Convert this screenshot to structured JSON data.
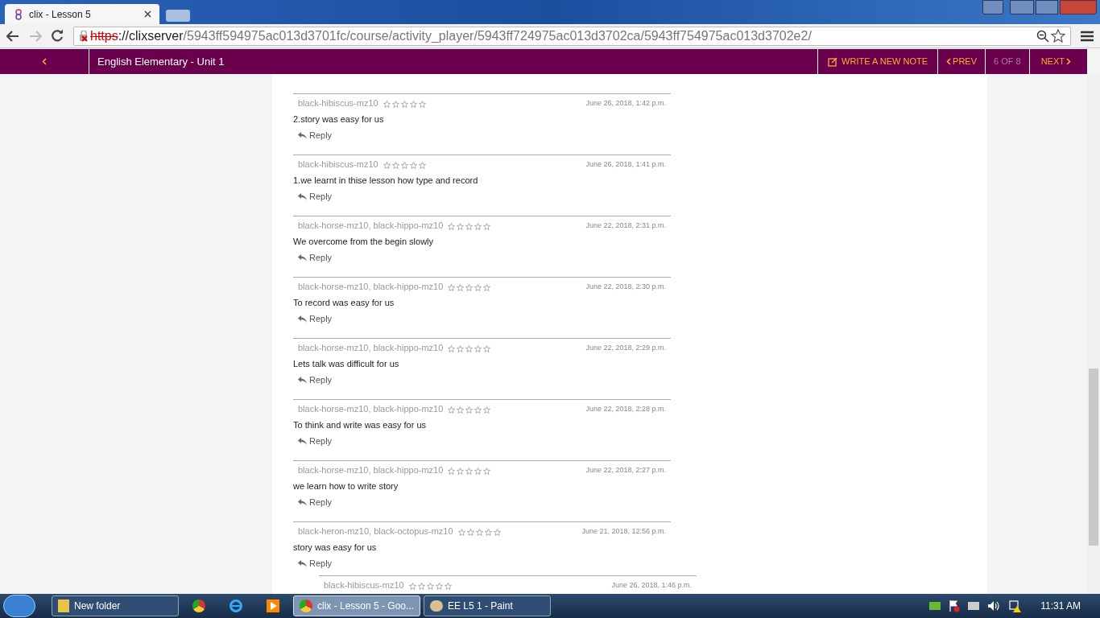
{
  "browser": {
    "tab_title": "clix - Lesson 5",
    "url_scheme": "https",
    "url_host": "://clixserver",
    "url_path": "/5943ff594975ac013d3701fc/course/activity_player/5943ff724975ac013d3702ca/5943ff754975ac013d3702e2/"
  },
  "header": {
    "title": "English Elementary - Unit 1",
    "write_note": "WRITE A NEW NOTE",
    "prev": "PREV",
    "position": "6 OF 8",
    "next": "NEXT"
  },
  "comments": [
    {
      "authors": "black-hibiscus-mz10",
      "stars": 0,
      "date": "June 26, 2018, 1:42 p.m.",
      "text": "2.story was easy for us",
      "reply": "Reply"
    },
    {
      "authors": "black-hibiscus-mz10",
      "stars": 0,
      "date": "June 26, 2018, 1:41 p.m.",
      "text": "1.we learnt in thise lesson how type and record",
      "reply": "Reply"
    },
    {
      "authors": "black-horse-mz10, black-hippo-mz10",
      "stars": 0,
      "date": "June 22, 2018, 2:31 p.m.",
      "text": "We overcome from the begin slowly",
      "reply": "Reply"
    },
    {
      "authors": "black-horse-mz10, black-hippo-mz10",
      "stars": 0,
      "date": "June 22, 2018, 2:30 p.m.",
      "text": "To record was easy for us",
      "reply": "Reply"
    },
    {
      "authors": "black-horse-mz10, black-hippo-mz10",
      "stars": 0,
      "date": "June 22, 2018, 2:29 p.m.",
      "text": "Lets talk was difficult for us",
      "reply": "Reply"
    },
    {
      "authors": "black-horse-mz10, black-hippo-mz10",
      "stars": 0,
      "date": "June 22, 2018, 2:28 p.m.",
      "text": "To think and write was easy for us",
      "reply": "Reply"
    },
    {
      "authors": "black-horse-mz10, black-hippo-mz10",
      "stars": 0,
      "date": "June 22, 2018, 2:27 p.m.",
      "text": "we learn how to write story",
      "reply": "Reply"
    },
    {
      "authors": "black-heron-mz10, black-octopus-mz10",
      "stars": 0,
      "date": "June 21, 2018, 12:56 p.m.",
      "text": "story was easy for us",
      "reply": "Reply",
      "children": [
        {
          "authors": "black-hibiscus-mz10",
          "stars": 0,
          "date": "June 26, 2018, 1:46 p.m."
        }
      ]
    }
  ],
  "taskbar": {
    "items": [
      {
        "kind": "window",
        "label": "New folder",
        "selected": false
      },
      {
        "kind": "pinned",
        "selected": false
      },
      {
        "kind": "pinned2",
        "selected": false
      },
      {
        "kind": "pinned3",
        "selected": false
      },
      {
        "kind": "chrome",
        "label": "clix - Lesson 5 - Goo...",
        "selected": true
      },
      {
        "kind": "paint",
        "label": "EE L5 1 - Paint",
        "selected": false
      }
    ],
    "clock": "11:31 AM"
  }
}
